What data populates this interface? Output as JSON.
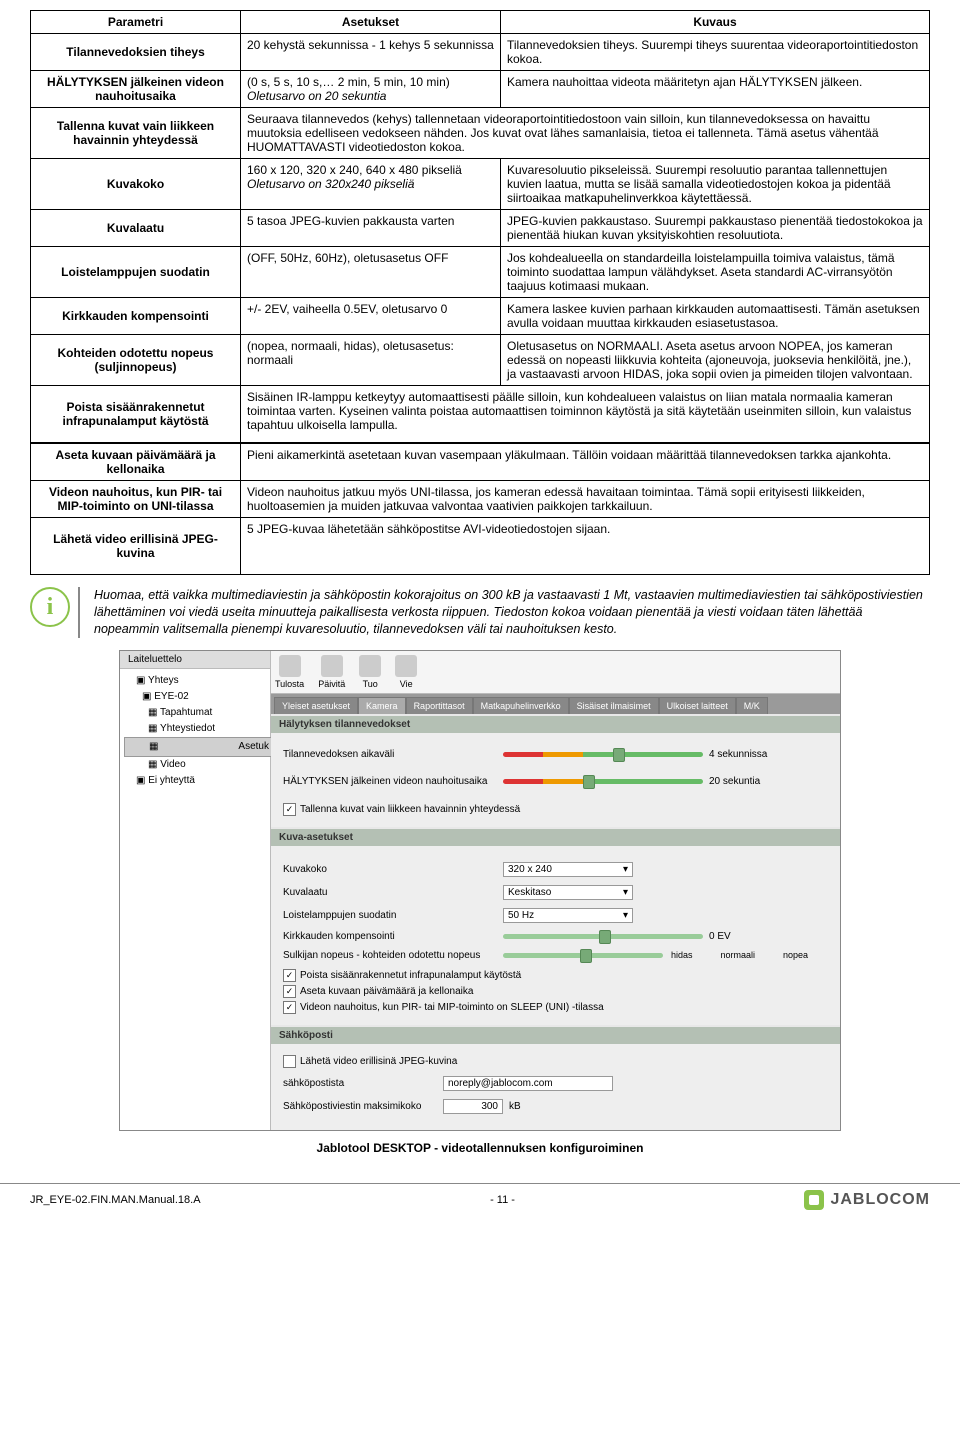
{
  "table": {
    "headers": [
      "Parametri",
      "Asetukset",
      "Kuvaus"
    ],
    "rows": [
      {
        "param": "Tilannevedoksien tiheys",
        "setting": "20 kehystä sekunnissa - 1 kehys 5 sekunnissa",
        "desc": "Tilannevedoksien tiheys. Suurempi tiheys suurentaa videoraportointitiedoston kokoa."
      },
      {
        "param": "HÄLYTYKSEN jälkeinen videon nauhoitusaika",
        "setting_l1": "(0 s, 5 s, 10 s,… 2 min, 5 min, 10 min)",
        "setting_l2": "Oletusarvo on 20 sekuntia",
        "desc": "Kamera nauhoittaa videota määritetyn ajan HÄLYTYKSEN jälkeen."
      },
      {
        "param": "Tallenna kuvat vain liikkeen havainnin yhteydessä",
        "wide": "Seuraava tilannevedos (kehys) tallennetaan videoraportointitiedostoon vain silloin, kun tilannevedoksessa on havaittu muutoksia edelliseen vedokseen nähden. Jos kuvat ovat lähes samanlaisia, tietoa ei tallenneta. Tämä asetus vähentää HUOMATTAVASTI videotiedoston kokoa."
      },
      {
        "param": "Kuvakoko",
        "setting_l1": "160 x 120, 320 x 240, 640 x 480 pikseliä",
        "setting_l2": "Oletusarvo on 320x240 pikseliä",
        "desc": "Kuvaresoluutio pikseleissä. Suurempi resoluutio parantaa tallennettujen kuvien laatua, mutta se lisää samalla videotiedostojen kokoa ja pidentää siirtoaikaa matkapuhelinverkkoa käytettäessä."
      },
      {
        "param": "Kuvalaatu",
        "setting": "5 tasoa JPEG-kuvien pakkausta varten",
        "desc": "JPEG-kuvien pakkaustaso. Suurempi pakkaustaso pienentää tiedostokokoa ja pienentää hiukan kuvan yksityiskohtien resoluutiota."
      },
      {
        "param": "Loistelamppujen suodatin",
        "setting": "(OFF, 50Hz, 60Hz), oletusasetus OFF",
        "desc": "Jos kohdealueella on standardeilla loistelampuilla toimiva valaistus, tämä toiminto suodattaa lampun välähdykset. Aseta standardi AC-virransyötön taajuus kotimaasi mukaan."
      },
      {
        "param": "Kirkkauden kompensointi",
        "setting": "+/- 2EV, vaiheella 0.5EV, oletusarvo 0",
        "desc": "Kamera laskee kuvien parhaan kirkkauden automaattisesti. Tämän asetuksen avulla voidaan muuttaa kirkkauden esiasetustasoa."
      },
      {
        "param": "Kohteiden odotettu nopeus (suljinnopeus)",
        "setting": "(nopea, normaali, hidas), oletusasetus: normaali",
        "desc": "Oletusasetus on NORMAALI. Aseta asetus arvoon NOPEA, jos kameran edessä on nopeasti liikkuvia kohteita (ajoneuvoja, juoksevia henkilöitä, jne.), ja vastaavasti arvoon HIDAS, joka sopii ovien ja pimeiden tilojen valvontaan."
      },
      {
        "param": "Poista sisäänrakennetut infrapunalamput käytöstä",
        "wide": "Sisäinen IR-lamppu ketkeytyy automaattisesti päälle silloin, kun kohdealueen valaistus on liian matala normaalia kameran toimintaa varten. Kyseinen valinta poistaa automaattisen toiminnon käytöstä ja sitä käytetään useinmiten silloin, kun valaistus tapahtuu ulkoisella lampulla."
      },
      {
        "param": "Aseta kuvaan päivämäärä ja kellonaika",
        "wide": "Pieni aikamerkintä asetetaan kuvan vasempaan yläkulmaan. Tällöin voidaan määrittää tilannevedoksen tarkka ajankohta."
      },
      {
        "param": "Videon nauhoitus, kun PIR- tai MIP-toiminto on UNI-tilassa",
        "wide": "Videon nauhoitus jatkuu myös UNI-tilassa, jos kameran edessä havaitaan toimintaa. Tämä sopii erityisesti liikkeiden, huoltoasemien ja muiden jatkuvaa valvontaa vaativien paikkojen tarkkailuun."
      },
      {
        "param": "Lähetä video erillisinä JPEG-kuvina",
        "wide": "5 JPEG-kuvaa lähetetään sähköpostitse AVI-videotiedostojen sijaan."
      }
    ]
  },
  "info": "Huomaa, että vaikka multimediaviestin ja sähköpostin kokorajoitus on 300 kB ja vastaavasti 1 Mt, vastaavien multimediaviestien tai sähköpostiviestien lähettäminen voi viedä useita minuutteja paikallisesta verkosta riippuen. Tiedoston kokoa voidaan pienentää ja viesti voidaan täten lähettää nopeammin valitsemalla pienempi kuvaresoluutio, tilannevedoksen väli tai nauhoituksen kesto.",
  "screenshot": {
    "sidebar_title": "Laiteluettelo",
    "tree": {
      "root": "Yhteys",
      "device": "EYE-02",
      "items": [
        "Tapahtumat",
        "Yhteystiedot",
        "Asetuk",
        "Video"
      ],
      "disconnected": "Ei yhteyttä"
    },
    "toolbar": [
      "Tulosta",
      "Päivitä",
      "Tuo",
      "Vie"
    ],
    "tabs": [
      "Yleiset asetukset",
      "Kamera",
      "Raportittasot",
      "Matkapuhelinverkko",
      "Sisäiset ilmaisimet",
      "Ulkoiset laitteet",
      "M/K"
    ],
    "section1": "Hälytyksen tilannevedokset",
    "row1_label": "Tilannevedoksen aikaväli",
    "row1_val": "4 sekunnissa",
    "row2_label": "HÄLYTYKSEN jälkeinen videon nauhoitusaika",
    "row2_val": "20 sekuntia",
    "chk1": "Tallenna kuvat vain liikkeen havainnin yhteydessä",
    "section2": "Kuva-asetukset",
    "row3_label": "Kuvakoko",
    "row3_val": "320 x 240",
    "row4_label": "Kuvalaatu",
    "row4_val": "Keskitaso",
    "row5_label": "Loistelamppujen suodatin",
    "row5_val": "50 Hz",
    "row6_label": "Kirkkauden kompensointi",
    "row6_val": "0  EV",
    "row7_label": "Sulkijan nopeus - kohteiden odotettu nopeus",
    "row7_marks": [
      "hidas",
      "normaali",
      "nopea"
    ],
    "chk2": "Poista sisäänrakennetut infrapunalamput käytöstä",
    "chk3": "Aseta kuvaan päivämäärä ja kellonaika",
    "chk4": "Videon nauhoitus, kun PIR- tai MIP-toiminto on SLEEP (UNI) -tilassa",
    "section3": "Sähköposti",
    "chk5": "Lähetä video erillisinä JPEG-kuvina",
    "row8_label": "sähköpostista",
    "row8_val": "noreply@jablocom.com",
    "row9_label": "Sähköpostiviestin maksimikoko",
    "row9_val": "300",
    "row9_unit": "kB"
  },
  "caption": "Jablotool DESKTOP - videotallennuksen konfiguroiminen",
  "footer": {
    "doc": "JR_EYE-02.FIN.MAN.Manual.18.A",
    "page": "- 11 -",
    "brand": "JABLOCOM"
  }
}
